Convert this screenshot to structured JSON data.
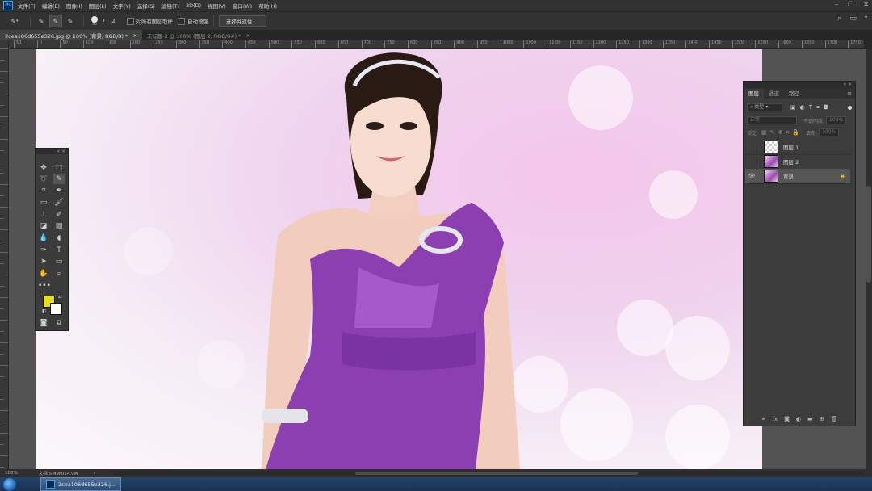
{
  "menubar": {
    "items": [
      "文件(F)",
      "编辑(E)",
      "图像(I)",
      "图层(L)",
      "文字(Y)",
      "选择(S)",
      "滤镜(T)",
      "3D(D)",
      "视图(V)",
      "窗口(W)",
      "帮助(H)"
    ]
  },
  "options": {
    "brush_size": "30",
    "sample_all_layers": "对所有图层取样",
    "auto_enhance": "自动增强",
    "select_and_mask": "选择并遮住 ..."
  },
  "tabs": [
    {
      "label": "2cea106d655e326.jpg @ 100% (背景, RGB/8) *",
      "close": "×"
    },
    {
      "label": "未标题-2 @ 100% (图层 2, RGB/8#) *",
      "close": "×"
    }
  ],
  "ruler": {
    "marks": [
      "50",
      "0",
      "50",
      "100",
      "150",
      "200",
      "250",
      "300",
      "350",
      "400",
      "450",
      "500",
      "550",
      "600",
      "650",
      "700",
      "750",
      "800",
      "850",
      "900",
      "950",
      "1000",
      "1050",
      "1100",
      "1150",
      "1200",
      "1250",
      "1300",
      "1350",
      "1400",
      "1450",
      "1500",
      "1550",
      "1600",
      "1650",
      "1700",
      "1750",
      "1800"
    ]
  },
  "status": {
    "zoom": "100%",
    "doc_info": "文档:5.49M/14.9M"
  },
  "taskbar": {
    "item": "2cea106d655e326.j..."
  },
  "colors": {
    "foreground": "#e8e010",
    "background": "#ffffff"
  },
  "layers_panel": {
    "tabs": [
      "图层",
      "通道",
      "路径"
    ],
    "filter_kind": "类型",
    "blend_mode": "正常",
    "opacity_label": "不透明度:",
    "opacity_value": "100%",
    "lock_label": "锁定:",
    "fill_label": "填充:",
    "fill_value": "100%",
    "layers": [
      {
        "name": "图层 1",
        "visible": false,
        "thumb": "checker"
      },
      {
        "name": "图层 2",
        "visible": false,
        "thumb": "photo"
      },
      {
        "name": "背景",
        "visible": true,
        "thumb": "photo",
        "locked": true
      }
    ]
  }
}
